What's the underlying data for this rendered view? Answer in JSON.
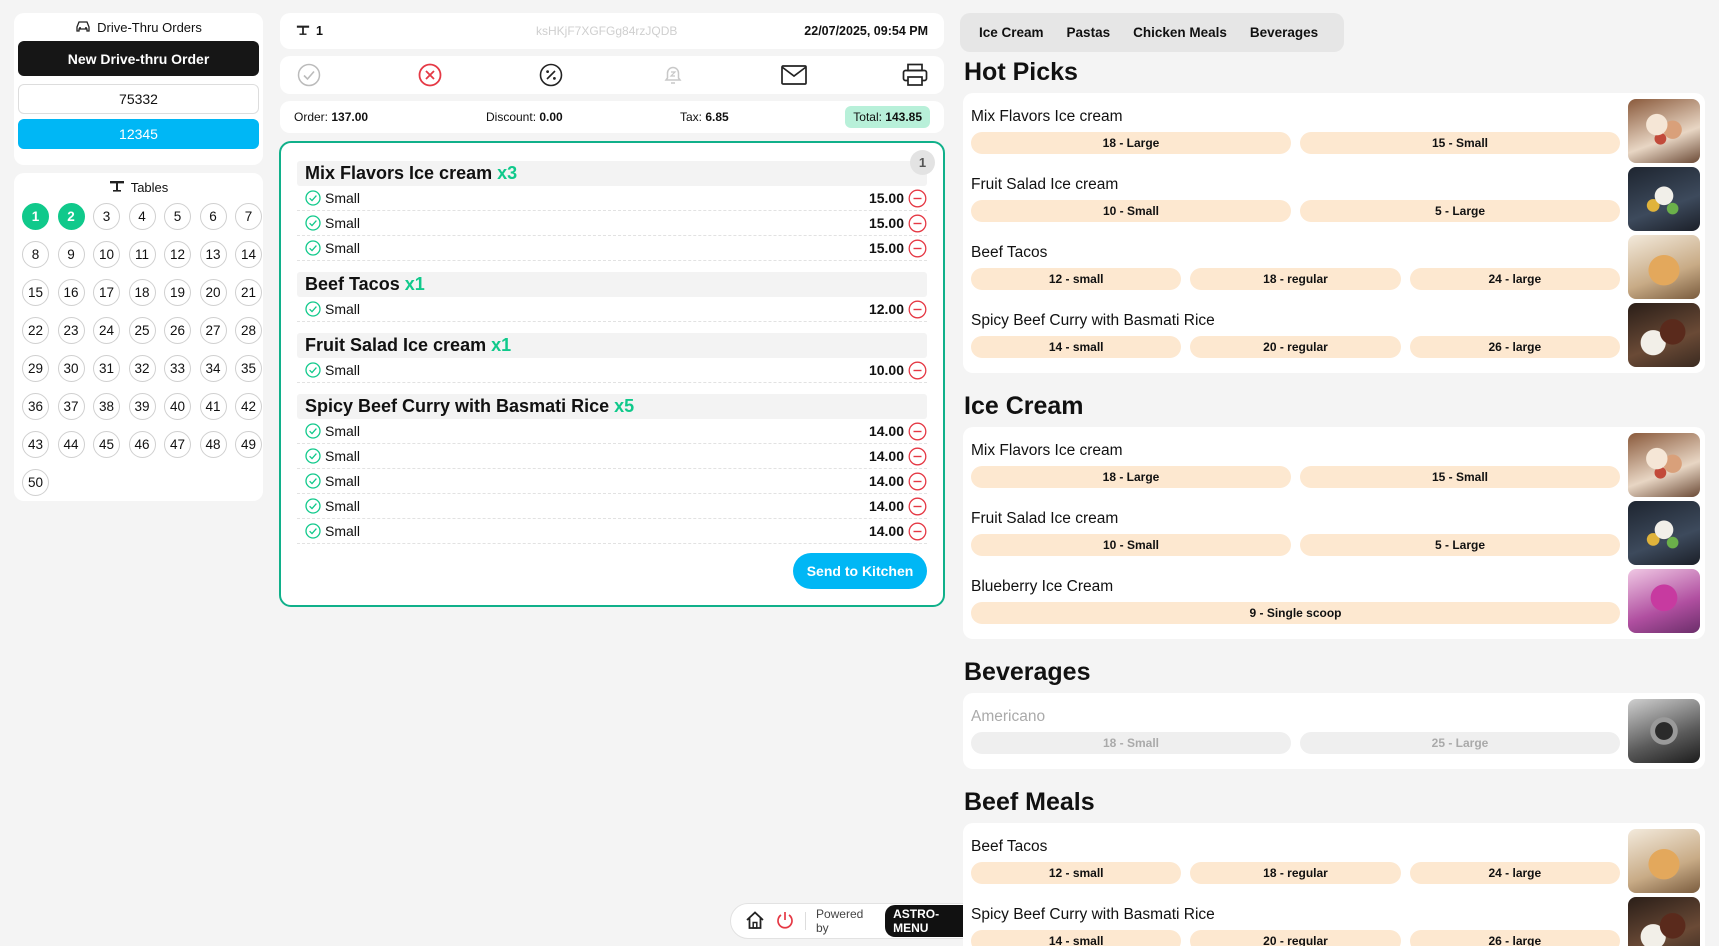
{
  "drive": {
    "title": "Drive-Thru Orders",
    "new_label": "New Drive-thru Order",
    "orders": [
      "75332",
      "12345"
    ]
  },
  "tables": {
    "title": "Tables",
    "numbers": [
      "1",
      "2",
      "3",
      "4",
      "5",
      "6",
      "7",
      "8",
      "9",
      "10",
      "11",
      "12",
      "13",
      "14",
      "15",
      "16",
      "17",
      "18",
      "19",
      "20",
      "21",
      "22",
      "23",
      "24",
      "25",
      "26",
      "27",
      "28",
      "29",
      "30",
      "31",
      "32",
      "33",
      "34",
      "35",
      "36",
      "37",
      "38",
      "39",
      "40",
      "41",
      "42",
      "43",
      "44",
      "45",
      "46",
      "47",
      "48",
      "49",
      "50"
    ],
    "busy": [
      "1",
      "2"
    ]
  },
  "order_header": {
    "table_number": "1",
    "order_id": "ksHKjF7XGFGg84rzJQDB",
    "datetime": "22/07/2025, 09:54 PM"
  },
  "totals": {
    "order_label": "Order:",
    "order_value": "137.00",
    "discount_label": "Discount:",
    "discount_value": "0.00",
    "tax_label": "Tax:",
    "tax_value": "6.85",
    "total_label": "Total:",
    "total_value": "143.85"
  },
  "cart": {
    "count": "1",
    "items": [
      {
        "name": "Mix Flavors Ice cream",
        "qty": "x3",
        "lines": [
          {
            "size": "Small",
            "price": "15.00"
          },
          {
            "size": "Small",
            "price": "15.00"
          },
          {
            "size": "Small",
            "price": "15.00"
          }
        ]
      },
      {
        "name": "Beef Tacos",
        "qty": "x1",
        "lines": [
          {
            "size": "Small",
            "price": "12.00"
          }
        ]
      },
      {
        "name": "Fruit Salad Ice cream",
        "qty": "x1",
        "lines": [
          {
            "size": "Small",
            "price": "10.00"
          }
        ]
      },
      {
        "name": "Spicy Beef Curry with Basmati Rice",
        "qty": "x5",
        "lines": [
          {
            "size": "Small",
            "price": "14.00"
          },
          {
            "size": "Small",
            "price": "14.00"
          },
          {
            "size": "Small",
            "price": "14.00"
          },
          {
            "size": "Small",
            "price": "14.00"
          },
          {
            "size": "Small",
            "price": "14.00"
          }
        ]
      }
    ],
    "send_label": "Send to Kitchen"
  },
  "categories": [
    "Ice Cream",
    "Pastas",
    "Chicken Meals",
    "Beverages"
  ],
  "sections": [
    {
      "title": "Hot Picks",
      "products": [
        {
          "name": "Mix Flavors Ice cream",
          "img": "icecream",
          "options": [
            "18 - Large",
            "15 - Small"
          ]
        },
        {
          "name": "Fruit Salad Ice cream",
          "img": "fruit",
          "options": [
            "10 - Small",
            "5 - Large"
          ]
        },
        {
          "name": "Beef Tacos",
          "img": "tacos",
          "options": [
            "12 - small",
            "18 - regular",
            "24 - large"
          ]
        },
        {
          "name": "Spicy Beef Curry with Basmati Rice",
          "img": "curry",
          "options": [
            "14 - small",
            "20 - regular",
            "26 - large"
          ]
        }
      ]
    },
    {
      "title": "Ice Cream",
      "products": [
        {
          "name": "Mix Flavors Ice cream",
          "img": "icecream",
          "options": [
            "18 - Large",
            "15 - Small"
          ]
        },
        {
          "name": "Fruit Salad Ice cream",
          "img": "fruit",
          "options": [
            "10 - Small",
            "5 - Large"
          ]
        },
        {
          "name": "Blueberry Ice Cream",
          "img": "blueberry",
          "options": [
            "9 - Single scoop"
          ]
        }
      ]
    },
    {
      "title": "Beverages",
      "products": [
        {
          "name": "Americano",
          "img": "coffee",
          "disabled": true,
          "options": [
            "18 - Small",
            "25 - Large"
          ]
        }
      ]
    },
    {
      "title": "Beef Meals",
      "products": [
        {
          "name": "Beef Tacos",
          "img": "tacos",
          "options": [
            "12 - small",
            "18 - regular",
            "24 - large"
          ]
        },
        {
          "name": "Spicy Beef Curry with Basmati Rice",
          "img": "curry",
          "options": [
            "14 - small",
            "20 - regular",
            "26 - large"
          ]
        }
      ]
    }
  ],
  "footer": {
    "powered_by": "Powered by",
    "brand": "ASTRO-MENU"
  },
  "colors": {
    "accent_green": "#10c98b",
    "accent_blue": "#00b7f5",
    "option_bg": "#fde8d0",
    "cancel_red": "#e53945"
  }
}
